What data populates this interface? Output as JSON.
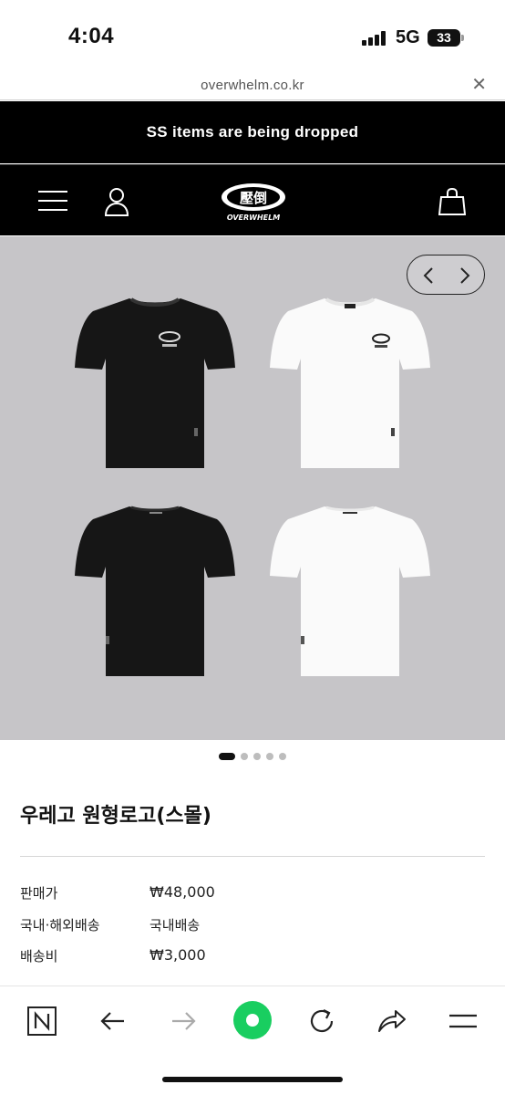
{
  "status_bar": {
    "time": "4:04",
    "network": "5G",
    "battery": "33"
  },
  "browser": {
    "url": "overwhelm.co.kr",
    "close_icon": "close-icon"
  },
  "announcement": {
    "text": "SS items are being dropped"
  },
  "header": {
    "brand_name": "OVERWHELM",
    "logo_glyphs": "壓倒",
    "icons": [
      "menu-icon",
      "user-icon",
      "shopping-bag-icon"
    ]
  },
  "gallery": {
    "background_color": "#c6c5c8",
    "products_shown": [
      {
        "color": "black",
        "side": "front"
      },
      {
        "color": "white",
        "side": "front"
      },
      {
        "color": "black",
        "side": "back"
      },
      {
        "color": "white",
        "side": "back"
      }
    ],
    "image_count": 5,
    "active_index": 0
  },
  "product": {
    "title": "우레고 원형로고(스몰)",
    "rows": [
      {
        "label": "판매가",
        "value": "₩48,000"
      },
      {
        "label": "국내·해외배송",
        "value": "국내배송"
      },
      {
        "label": "배송비",
        "value": "₩3,000"
      }
    ]
  },
  "toolbar": {
    "accent_color": "#19ce60",
    "items": [
      "naver-n-icon",
      "back-arrow-icon",
      "forward-arrow-icon",
      "green-dot-icon",
      "reload-icon",
      "share-icon",
      "menu-lines-icon"
    ]
  }
}
